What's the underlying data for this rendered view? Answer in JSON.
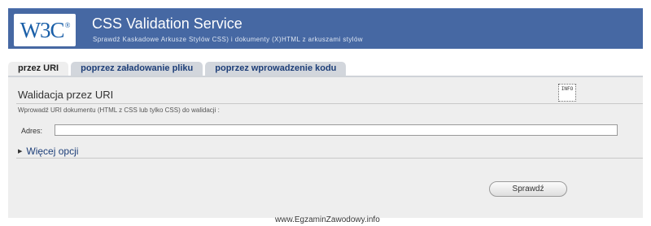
{
  "header": {
    "logo_text": "W3C",
    "logo_mark": "®",
    "title": "CSS Validation Service",
    "subtitle": "Sprawdź Kaskadowe Arkusze Stylów CSS) i dokumenty (X)HTML z arkuszami stylów"
  },
  "tabs": [
    {
      "label": "przez URI",
      "active": true
    },
    {
      "label": "poprzez załadowanie pliku",
      "active": false
    },
    {
      "label": "poprzez wprowadzenie kodu",
      "active": false
    }
  ],
  "panel": {
    "title": "Walidacja przez URI",
    "hint": "Wprowadź URI dokumentu (HTML z CSS lub tylko CSS) do walidacji :",
    "address_label": "Adres:",
    "address_value": "",
    "address_placeholder": "",
    "more_options": "Więcej opcji",
    "submit_label": "Sprawdź",
    "info_icon": "info-icon",
    "info_text": "INFO"
  },
  "watermark": "www.EgzaminZawodowy.info",
  "colors": {
    "banner": "#4668a3",
    "panel": "#eeeeee",
    "tab_inactive": "#d2d6dc",
    "tab_text": "#1d3e78"
  }
}
